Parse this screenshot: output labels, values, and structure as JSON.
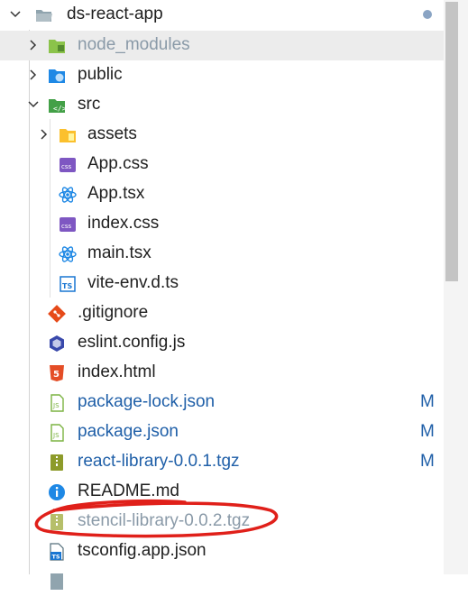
{
  "explorer": {
    "root": {
      "label": "ds-react-app"
    },
    "items": [
      {
        "label": "node_modules"
      },
      {
        "label": "public"
      },
      {
        "label": "src"
      },
      {
        "label": "assets"
      },
      {
        "label": "App.css"
      },
      {
        "label": "App.tsx"
      },
      {
        "label": "index.css"
      },
      {
        "label": "main.tsx"
      },
      {
        "label": "vite-env.d.ts"
      },
      {
        "label": ".gitignore"
      },
      {
        "label": "eslint.config.js"
      },
      {
        "label": "index.html"
      },
      {
        "label": "package-lock.json",
        "git_status": "M"
      },
      {
        "label": "package.json",
        "git_status": "M"
      },
      {
        "label": "react-library-0.0.1.tgz",
        "git_status": "M"
      },
      {
        "label": "README.md"
      },
      {
        "label": "stencil-library-0.0.2.tgz"
      },
      {
        "label": "tsconfig.app.json"
      }
    ]
  },
  "icons": {
    "folder": "folder-icon",
    "css": "css-file-icon",
    "react": "react-icon",
    "typescript": "typescript-icon",
    "git": "git-icon",
    "eslint": "eslint-icon",
    "html": "html5-icon",
    "json": "json-icon",
    "archive": "zip-archive-icon",
    "info": "info-icon"
  },
  "colors": {
    "modified": "#1f5fa8",
    "ignored": "#8a9aa8",
    "annotation": "#e0201a",
    "selection": "#ececec"
  }
}
